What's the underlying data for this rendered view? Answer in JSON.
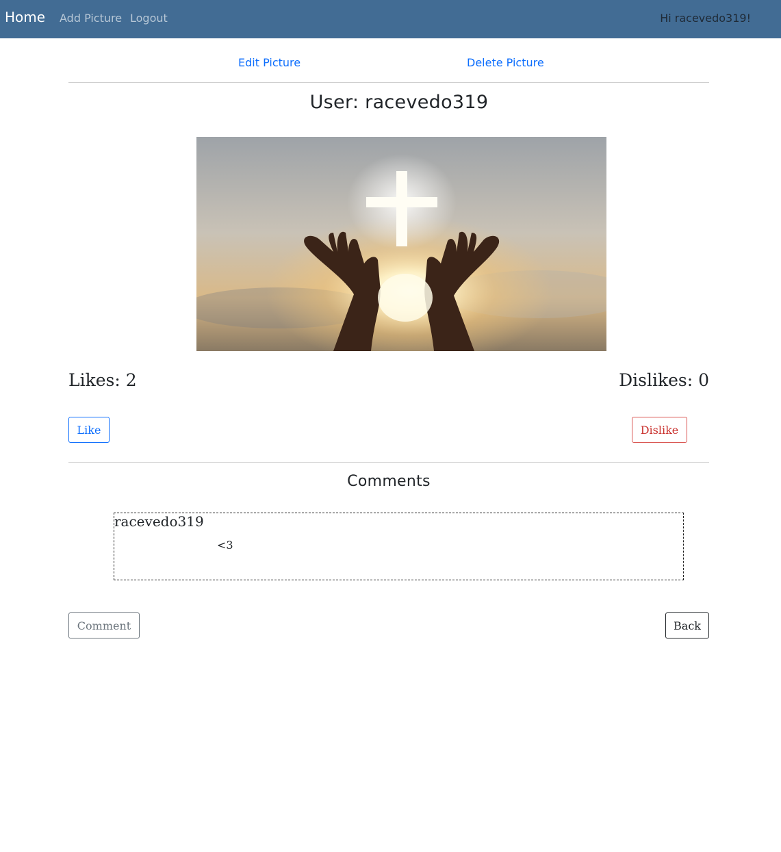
{
  "navbar": {
    "brand": "Home",
    "links": [
      "Add Picture",
      "Logout"
    ],
    "greeting": "Hi racevedo319!"
  },
  "actions": {
    "edit": "Edit Picture",
    "delete": "Delete Picture"
  },
  "picture": {
    "user_title": "User: racevedo319",
    "image_desc": "hands-raised-toward-glowing-cross-icon"
  },
  "reactions": {
    "likes_text": "Likes: 2",
    "dislikes_text": "Dislikes: 0",
    "like_button": "Like",
    "dislike_button": "Dislike"
  },
  "comments": {
    "title": "Comments",
    "items": [
      {
        "author": "racevedo319",
        "text": "<3"
      }
    ]
  },
  "footer": {
    "comment_button": "Comment",
    "back_button": "Back"
  },
  "colors": {
    "navbar": "#426c94",
    "link": "#0d6efd",
    "danger": "#c9302c"
  }
}
